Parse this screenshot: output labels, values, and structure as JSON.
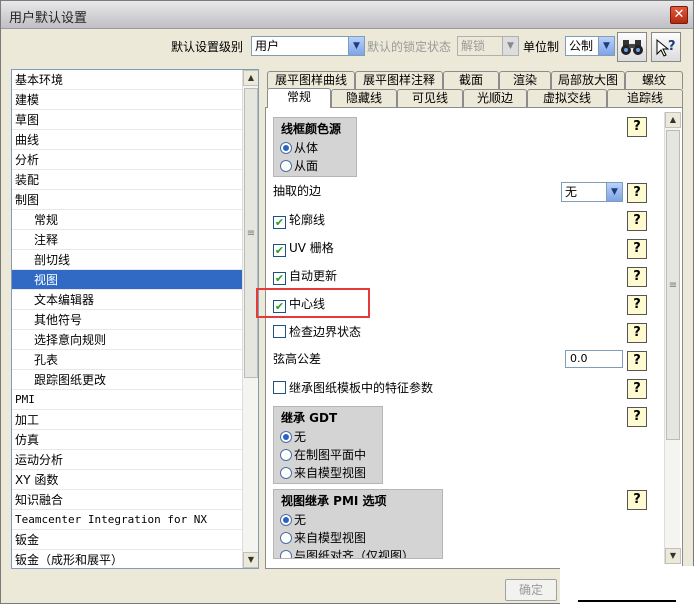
{
  "window": {
    "title": "用户默认设置",
    "close": "✕"
  },
  "toolbar": {
    "level_label": "默认设置级别",
    "level_value": "用户",
    "lock_label": "默认的锁定状态",
    "lock_value": "解锁",
    "unit_label": "单位制",
    "unit_value": "公制"
  },
  "tree": {
    "items": [
      {
        "label": "基本环境"
      },
      {
        "label": "建模"
      },
      {
        "label": "草图"
      },
      {
        "label": "曲线"
      },
      {
        "label": "分析"
      },
      {
        "label": "装配"
      },
      {
        "label": "制图"
      },
      {
        "label": "常规"
      },
      {
        "label": "注释"
      },
      {
        "label": "剖切线"
      },
      {
        "label": "视图"
      },
      {
        "label": "文本编辑器"
      },
      {
        "label": "其他符号"
      },
      {
        "label": "选择意向规则"
      },
      {
        "label": "孔表"
      },
      {
        "label": "跟踪图纸更改"
      },
      {
        "label": "PMI"
      },
      {
        "label": "加工"
      },
      {
        "label": "仿真"
      },
      {
        "label": "运动分析"
      },
      {
        "label": "XY 函数"
      },
      {
        "label": "知识融合"
      },
      {
        "label": "Teamcenter Integration for NX"
      },
      {
        "label": "钣金"
      },
      {
        "label": "钣金（成形和展平）"
      }
    ],
    "selected": "视图"
  },
  "tabs": {
    "row1": [
      "展平图样曲线",
      "展平图样注释",
      "截面",
      "渲染",
      "局部放大图",
      "螺纹"
    ],
    "row2": [
      "常规",
      "隐藏线",
      "可见线",
      "光顺边",
      "虚拟交线",
      "追踪线"
    ],
    "active": "常规"
  },
  "content": {
    "wire_color": {
      "title": "线框颜色源",
      "opt1": "从体",
      "opt2": "从面",
      "selected": "从体"
    },
    "extracted_edges": {
      "label": "抽取的边",
      "value": "无"
    },
    "silhouette": "轮廓线",
    "uv_grid": "UV 栅格",
    "auto_update": "自动更新",
    "centerline": "中心线",
    "check_boundary": "检查边界状态",
    "chord_tolerance": {
      "label": "弦高公差",
      "value": "0.0"
    },
    "inherit_template": "继承图纸模板中的特征参数",
    "inherit_gdt": {
      "title": "继承 GDT",
      "opt1": "无",
      "opt2": "在制图平面中",
      "opt3": "来自模型视图",
      "selected": "无"
    },
    "view_inherit_pmi": {
      "title": "视图继承 PMI 选项",
      "opt1": "无",
      "opt2": "来自模型视图",
      "opt3": "与图纸对齐（仅视图）",
      "selected": "无"
    },
    "checked": [
      "轮廓线",
      "UV 栅格",
      "自动更新",
      "中心线"
    ],
    "help": "?"
  },
  "footer": {
    "ok_label": "确定"
  },
  "colors": {
    "accent": "#316ac5",
    "highlight": "#e53a3a",
    "window_bg": "#ece9d8"
  }
}
